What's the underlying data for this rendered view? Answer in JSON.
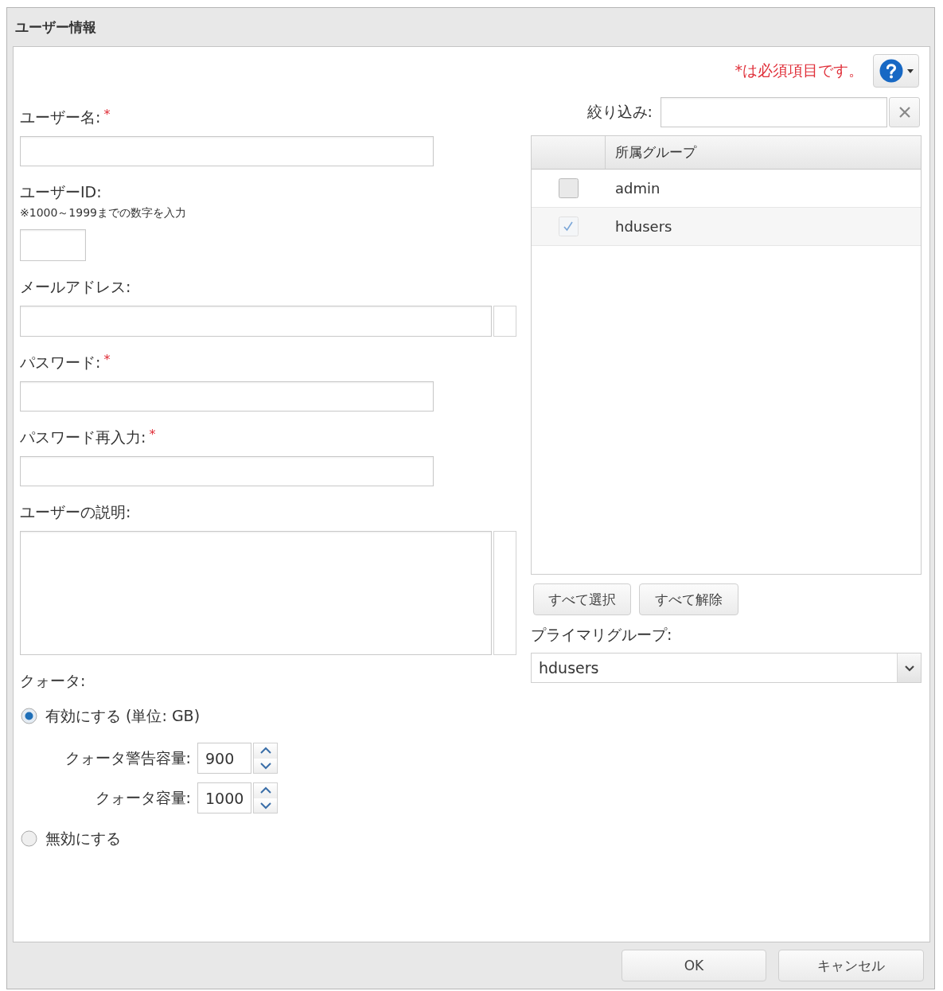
{
  "window": {
    "title": "ユーザー情報"
  },
  "required_note": "*は必須項目です。",
  "fields": [
    {
      "kind": "text",
      "label": "ユーザー名:",
      "mark": "*"
    },
    {
      "kind": "number",
      "label": "ユーザーID:",
      "hint": "※1000～1999までの数字を入力"
    },
    {
      "kind": "email",
      "label": "メールアドレス:"
    },
    {
      "kind": "password",
      "label": "パスワード:",
      "mark": "*"
    },
    {
      "kind": "password",
      "label": "パスワード再入力:",
      "mark": "*"
    },
    {
      "kind": "textarea",
      "label": "ユーザーの説明:"
    }
  ],
  "quota": {
    "label": "クォータ:",
    "options": [
      {
        "label": "有効にする (単位: GB)",
        "selected": true,
        "settings": [
          {
            "label": "クォータ警告容量:",
            "value": "900"
          },
          {
            "label": "クォータ容量:",
            "value": "1000"
          }
        ]
      },
      {
        "label": "無効にする",
        "selected": false
      }
    ]
  },
  "filter": {
    "label": "絞り込み:"
  },
  "groups": {
    "column_header": "所属グループ",
    "rows": [
      {
        "name": "admin",
        "checked": false
      },
      {
        "name": "hdusers",
        "checked": true
      }
    ]
  },
  "group_buttons": [
    "すべて選択",
    "すべて解除"
  ],
  "primary_group": {
    "label": "プライマリグループ:",
    "value": "hdusers"
  },
  "buttons": [
    "OK",
    "キャンセル"
  ]
}
